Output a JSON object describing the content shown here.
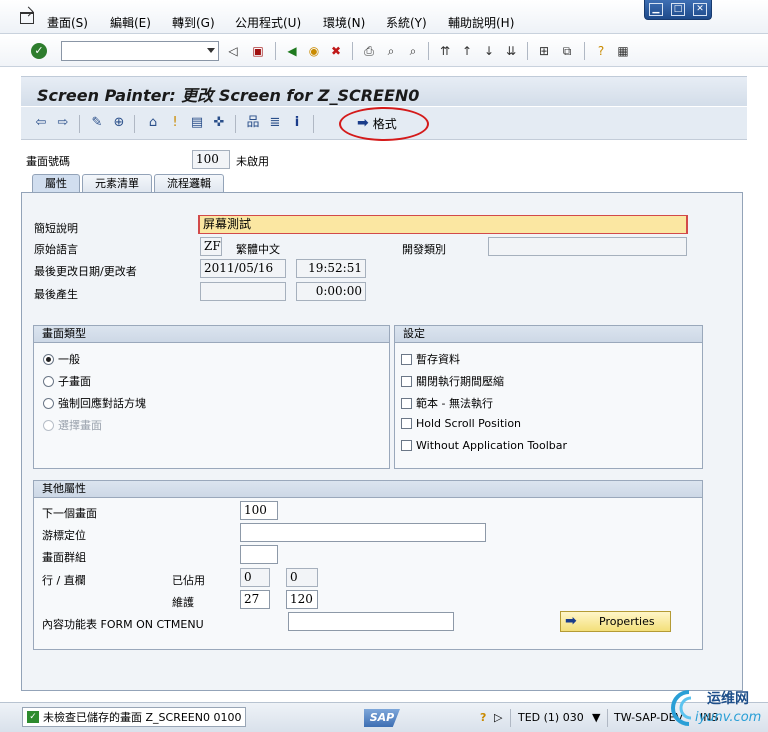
{
  "menu": [
    "畫面(S)",
    "編輯(E)",
    "轉到(G)",
    "公用程式(U)",
    "環境(N)",
    "系統(Y)",
    "輔助說明(H)"
  ],
  "window_controls": {
    "minimize": "▁",
    "maximize": "□",
    "close": "✕"
  },
  "command_field": {
    "value": ""
  },
  "title": "Screen Painter: 更改 Screen for Z_SCREEN0",
  "app_toolbar": {
    "format_label": "格式"
  },
  "header": {
    "screen_number_label": "畫面號碼",
    "screen_number": "100",
    "status": "未啟用"
  },
  "tabs": [
    "屬性",
    "元素清單",
    "流程邏輯"
  ],
  "attributes": {
    "short_desc_label": "簡短說明",
    "short_desc": "屏幕測試",
    "orig_lang_label": "原始語言",
    "orig_lang_code": "ZF",
    "orig_lang_name": "繁體中文",
    "dev_class_label": "開發類別",
    "dev_class": "",
    "last_changed_label": "最後更改日期/更改者",
    "last_changed_date": "2011/05/16",
    "last_changed_time": "19:52:51",
    "last_generated_label": "最後產生",
    "last_generated_date": "",
    "last_generated_time": "0:00:00"
  },
  "screen_type": {
    "title": "畫面類型",
    "options": [
      {
        "label": "一般",
        "selected": true,
        "disabled": false
      },
      {
        "label": "子畫面",
        "selected": false,
        "disabled": false
      },
      {
        "label": "強制回應對話方塊",
        "selected": false,
        "disabled": false
      },
      {
        "label": "選擇畫面",
        "selected": false,
        "disabled": true
      }
    ]
  },
  "settings": {
    "title": "設定",
    "options": [
      "暫存資料",
      "關閉執行期間壓縮",
      "範本 - 無法執行",
      "Hold Scroll Position",
      "Without Application Toolbar"
    ]
  },
  "other_attrs": {
    "title": "其他屬性",
    "next_screen_label": "下一個畫面",
    "next_screen": "100",
    "cursor_pos_label": "游標定位",
    "cursor_pos": "",
    "screen_group_label": "畫面群組",
    "screen_group": "",
    "lines_cols_label": "行 / 直欄",
    "used_label": "已佔用",
    "used_lines": "0",
    "used_cols": "0",
    "maintained_label": "維護",
    "maint_lines": "27",
    "maint_cols": "120",
    "context_menu_label": "內容功能表 FORM ON CTMENU",
    "context_menu": "",
    "properties_button": "Properties"
  },
  "status_bar": {
    "message": "未檢查已儲存的畫面 Z_SCREEN0 0100",
    "sap_logo": "SAP",
    "system": "TED (1) 030",
    "server": "TW-SAP-DEV",
    "mode": "INS"
  },
  "watermark": {
    "name": "运维网",
    "domain": "iyunv.com"
  }
}
